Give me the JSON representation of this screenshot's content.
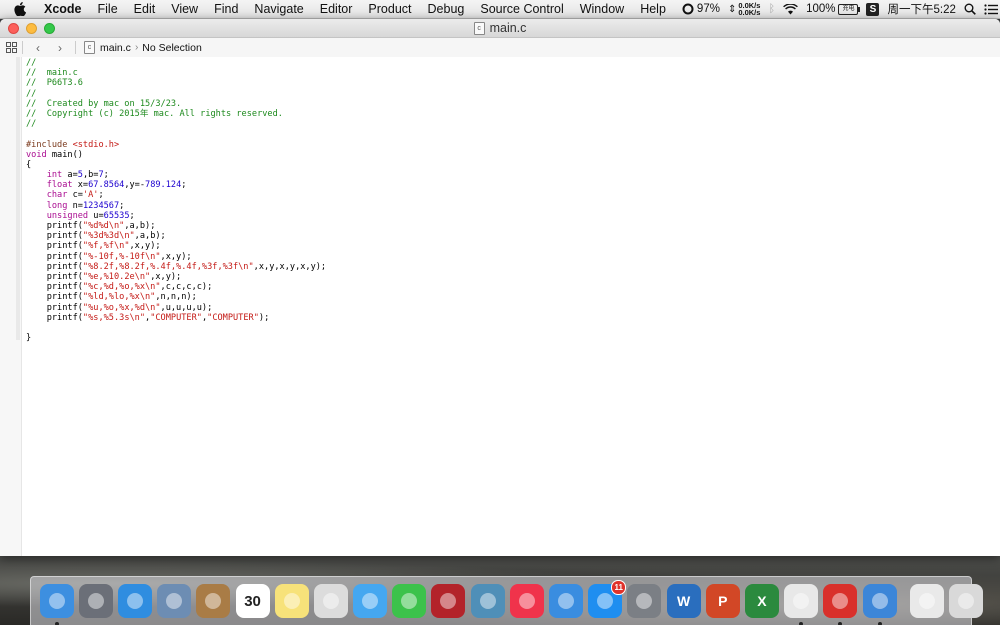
{
  "menubar": {
    "app_name": "Xcode",
    "menus": [
      "File",
      "Edit",
      "View",
      "Find",
      "Navigate",
      "Editor",
      "Product",
      "Debug",
      "Source Control",
      "Window",
      "Help"
    ],
    "status": {
      "sync_percent": "97%",
      "net_up": "0.0K/s",
      "net_down": "0.0K/s",
      "battery_percent": "100%",
      "battery_label": "充电",
      "clock": "周一下午5:22",
      "s_icon_label": "S"
    }
  },
  "window": {
    "title": "main.c",
    "jumpbar": {
      "file": "main.c",
      "selection": "No Selection"
    }
  },
  "code_lines": [
    [
      [
        "c-comment",
        "//"
      ]
    ],
    [
      [
        "c-comment",
        "//  main.c"
      ]
    ],
    [
      [
        "c-comment",
        "//  P66T3.6"
      ]
    ],
    [
      [
        "c-comment",
        "//"
      ]
    ],
    [
      [
        "c-comment",
        "//  Created by mac on 15/3/23."
      ]
    ],
    [
      [
        "c-comment",
        "//  Copyright (c) 2015年 mac. All rights reserved."
      ]
    ],
    [
      [
        "c-comment",
        "//"
      ]
    ],
    [
      [
        "",
        ""
      ]
    ],
    [
      [
        "c-pre",
        "#include "
      ],
      [
        "c-inc",
        "<stdio.h>"
      ]
    ],
    [
      [
        "c-kw",
        "void"
      ],
      [
        "",
        " main()"
      ]
    ],
    [
      [
        "",
        "{"
      ]
    ],
    [
      [
        "",
        "    "
      ],
      [
        "c-kw",
        "int"
      ],
      [
        "",
        " a="
      ],
      [
        "c-num",
        "5"
      ],
      [
        "",
        ",b="
      ],
      [
        "c-num",
        "7"
      ],
      [
        "",
        ";"
      ]
    ],
    [
      [
        "",
        "    "
      ],
      [
        "c-kw",
        "float"
      ],
      [
        "",
        " x="
      ],
      [
        "c-num",
        "67.8564"
      ],
      [
        "",
        ",y=-"
      ],
      [
        "c-num",
        "789.124"
      ],
      [
        "",
        ";"
      ]
    ],
    [
      [
        "",
        "    "
      ],
      [
        "c-kw",
        "char"
      ],
      [
        "",
        " c="
      ],
      [
        "c-str",
        "'A'"
      ],
      [
        "",
        ";"
      ]
    ],
    [
      [
        "",
        "    "
      ],
      [
        "c-kw",
        "long"
      ],
      [
        "",
        " n="
      ],
      [
        "c-num",
        "1234567"
      ],
      [
        "",
        ";"
      ]
    ],
    [
      [
        "",
        "    "
      ],
      [
        "c-kw",
        "unsigned"
      ],
      [
        "",
        " u="
      ],
      [
        "c-num",
        "65535"
      ],
      [
        "",
        ";"
      ]
    ],
    [
      [
        "",
        "    printf("
      ],
      [
        "c-str",
        "\"%d%d\\n\""
      ],
      [
        "",
        ",a,b);"
      ]
    ],
    [
      [
        "",
        "    printf("
      ],
      [
        "c-str",
        "\"%3d%3d\\n\""
      ],
      [
        "",
        ",a,b);"
      ]
    ],
    [
      [
        "",
        "    printf("
      ],
      [
        "c-str",
        "\"%f,%f\\n\""
      ],
      [
        "",
        ",x,y);"
      ]
    ],
    [
      [
        "",
        "    printf("
      ],
      [
        "c-str",
        "\"%-10f,%-10f\\n\""
      ],
      [
        "",
        ",x,y);"
      ]
    ],
    [
      [
        "",
        "    printf("
      ],
      [
        "c-str",
        "\"%8.2f,%8.2f,%.4f,%.4f,%3f,%3f\\n\""
      ],
      [
        "",
        ",x,y,x,y,x,y);"
      ]
    ],
    [
      [
        "",
        "    printf("
      ],
      [
        "c-str",
        "\"%e,%10.2e\\n\""
      ],
      [
        "",
        ",x,y);"
      ]
    ],
    [
      [
        "",
        "    printf("
      ],
      [
        "c-str",
        "\"%c,%d,%o,%x\\n\""
      ],
      [
        "",
        ",c,c,c,c);"
      ]
    ],
    [
      [
        "",
        "    printf("
      ],
      [
        "c-str",
        "\"%ld,%lo,%x\\n\""
      ],
      [
        "",
        ",n,n,n);"
      ]
    ],
    [
      [
        "",
        "    printf("
      ],
      [
        "c-str",
        "\"%u,%o,%x,%d\\n\""
      ],
      [
        "",
        ",u,u,u,u);"
      ]
    ],
    [
      [
        "",
        "    printf("
      ],
      [
        "c-str",
        "\"%s,%5.3s\\n\""
      ],
      [
        "",
        ","
      ],
      [
        "c-str",
        "\"COMPUTER\""
      ],
      [
        "",
        ","
      ],
      [
        "c-str",
        "\"COMPUTER\""
      ],
      [
        "",
        ");"
      ]
    ],
    [
      [
        "",
        "    "
      ]
    ],
    [
      [
        "",
        "}"
      ]
    ]
  ],
  "dock": {
    "items": [
      {
        "name": "finder",
        "icon": "finder-icon",
        "color": "#3d8fe0",
        "running": true
      },
      {
        "name": "launchpad",
        "icon": "rocket-icon",
        "color": "#6b6f78",
        "running": false
      },
      {
        "name": "safari",
        "icon": "compass-icon",
        "color": "#2f8de0",
        "running": false
      },
      {
        "name": "preview",
        "icon": "preview-icon",
        "color": "#6d8db3",
        "running": false
      },
      {
        "name": "contacts",
        "icon": "contacts-icon",
        "color": "#a97c46",
        "running": false
      },
      {
        "name": "calendar",
        "icon": "calendar-icon",
        "color": "#ffffff",
        "label": "30",
        "running": false
      },
      {
        "name": "notes",
        "icon": "notes-icon",
        "color": "#f7e27a",
        "running": false
      },
      {
        "name": "reminders",
        "icon": "reminders-icon",
        "color": "#dcdcdc",
        "running": false
      },
      {
        "name": "messages",
        "icon": "messages-icon",
        "color": "#45a7f0",
        "running": false
      },
      {
        "name": "facetime",
        "icon": "facetime-icon",
        "color": "#3cc24b",
        "running": false
      },
      {
        "name": "photo-booth",
        "icon": "photo-booth-icon",
        "color": "#b3232a",
        "running": false
      },
      {
        "name": "iphoto",
        "icon": "iphoto-icon",
        "color": "#4f8fb8",
        "running": false
      },
      {
        "name": "itunes",
        "icon": "itunes-icon",
        "color": "#f0334b",
        "running": false
      },
      {
        "name": "ibooks",
        "icon": "ibooks-icon",
        "color": "#3a8de0",
        "running": false
      },
      {
        "name": "app-store",
        "icon": "app-store-icon",
        "color": "#1f8ef0",
        "badge": "11",
        "running": false
      },
      {
        "name": "system-preferences",
        "icon": "gear-icon",
        "color": "#7b7f85",
        "running": false
      },
      {
        "name": "word",
        "icon": "word-icon",
        "color": "#2a6ebe",
        "label": "W",
        "running": false
      },
      {
        "name": "powerpoint",
        "icon": "powerpoint-icon",
        "color": "#d24726",
        "label": "P",
        "running": false
      },
      {
        "name": "excel",
        "icon": "excel-icon",
        "color": "#2b8a3e",
        "label": "X",
        "running": false
      },
      {
        "name": "chrome",
        "icon": "chrome-icon",
        "color": "#e8e8e8",
        "running": true
      },
      {
        "name": "netease-music",
        "icon": "netease-music-icon",
        "color": "#d9302b",
        "running": true
      },
      {
        "name": "xcode",
        "icon": "xcode-icon",
        "color": "#3c86d8",
        "running": true
      }
    ],
    "right_items": [
      {
        "name": "downloads-preview",
        "icon": "window-preview-icon",
        "color": "#e9e9e9"
      },
      {
        "name": "trash",
        "icon": "trash-icon",
        "color": "#d9d9d9"
      }
    ]
  }
}
